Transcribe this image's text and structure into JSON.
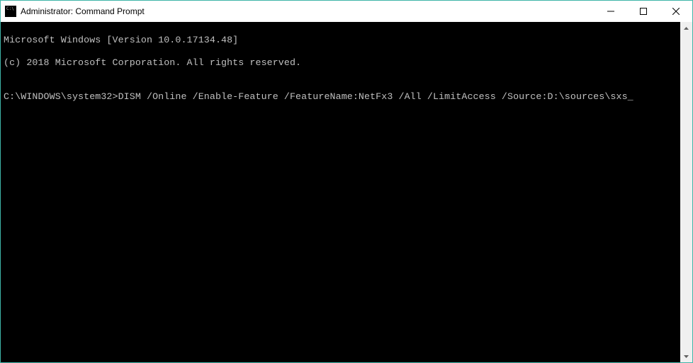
{
  "window": {
    "title": "Administrator: Command Prompt"
  },
  "terminal": {
    "line1": "Microsoft Windows [Version 10.0.17134.48]",
    "line2": "(c) 2018 Microsoft Corporation. All rights reserved.",
    "blank1": "",
    "prompt": "C:\\WINDOWS\\system32>",
    "command": "DISM /Online /Enable-Feature /FeatureName:NetFx3 /All /LimitAccess /Source:D:\\sources\\sxs"
  }
}
